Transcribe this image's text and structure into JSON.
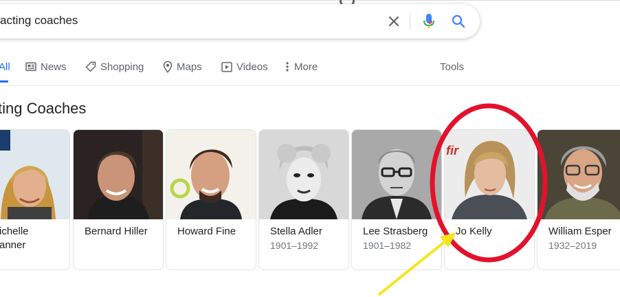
{
  "search": {
    "query": "acting coaches",
    "clear_icon": "close-icon",
    "mic_icon": "microphone-icon",
    "search_icon": "search-icon"
  },
  "tabs": [
    {
      "label": "All",
      "icon": null,
      "active": true
    },
    {
      "label": "News",
      "icon": "newspaper-icon"
    },
    {
      "label": "Shopping",
      "icon": "tag-icon"
    },
    {
      "label": "Maps",
      "icon": "map-pin-icon"
    },
    {
      "label": "Videos",
      "icon": "play-box-icon"
    },
    {
      "label": "More",
      "icon": "vertical-dots-icon"
    }
  ],
  "tools_label": "Tools",
  "section": {
    "title": "ting Coaches"
  },
  "cards": [
    {
      "name": "ichelle",
      "name2": "anner",
      "years": ""
    },
    {
      "name": "Bernard Hiller",
      "years": ""
    },
    {
      "name": "Howard Fine",
      "years": ""
    },
    {
      "name": "Stella Adler",
      "years": "1901–1992"
    },
    {
      "name": "Lee Strasberg",
      "years": "1901–1982"
    },
    {
      "name": "Jo Kelly",
      "years": ""
    },
    {
      "name": "William Esper",
      "years": "1932–2019"
    }
  ],
  "colors": {
    "accent": "#1a73e8",
    "highlight_circle": "#e3122b",
    "arrow": "#f5e51b"
  }
}
